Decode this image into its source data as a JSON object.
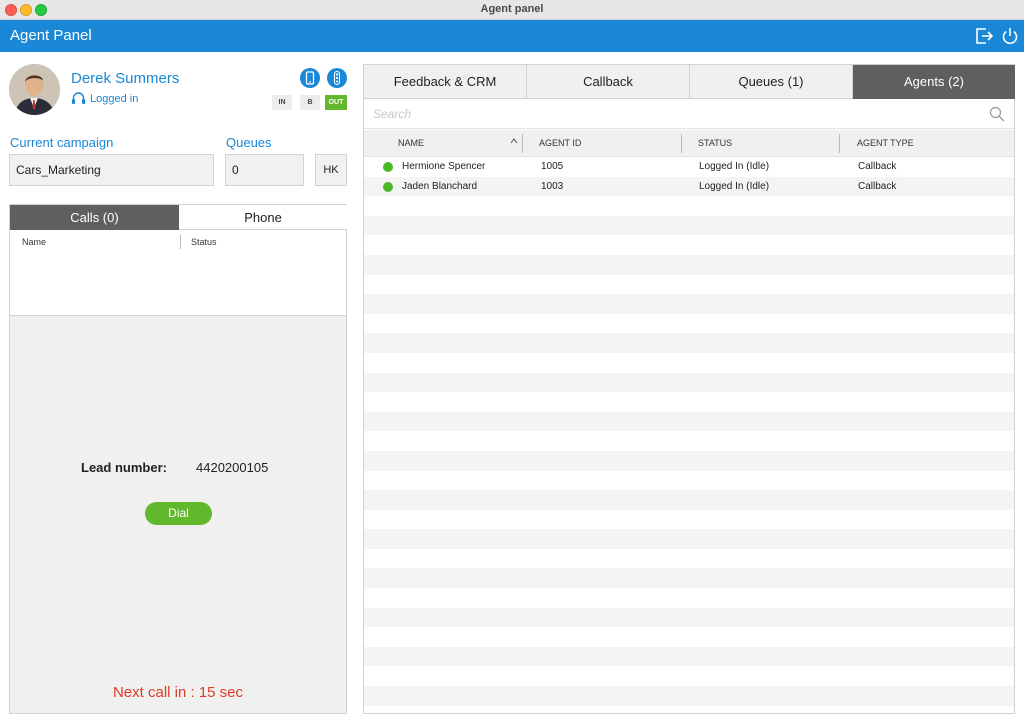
{
  "window": {
    "title": "Agent panel"
  },
  "header": {
    "title": "Agent Panel",
    "logout_icon": "logout-icon",
    "power_icon": "power-icon"
  },
  "colors": {
    "header_blue": "#1a88d6",
    "active_tab": "#5f5f5f",
    "green": "#61b82d",
    "alert_red": "#e03b24"
  },
  "agent": {
    "name": "Derek Summers",
    "status": "Logged in"
  },
  "modes": {
    "in": "IN",
    "b": "B",
    "out": "OUT",
    "active": "OUT"
  },
  "campaign": {
    "label": "Current campaign",
    "value": "Cars_Marketing"
  },
  "queues": {
    "label": "Queues",
    "value": "0",
    "hk_label": "HK"
  },
  "left_tabs": {
    "calls": "Calls (0)",
    "phone": "Phone",
    "active": "Calls (0)"
  },
  "calls_table": {
    "columns": [
      "Name",
      "Status"
    ]
  },
  "lead": {
    "label": "Lead number:",
    "number": "4420200105",
    "dial_label": "Dial"
  },
  "next_call": "Next call in : 15 sec",
  "right_tabs": [
    "Feedback & CRM",
    "Callback",
    "Queues (1)",
    "Agents (2)"
  ],
  "active_right_tab": "Agents (2)",
  "search": {
    "placeholder": "Search",
    "value": ""
  },
  "agents_table": {
    "columns": [
      "NAME",
      "AGENT ID",
      "STATUS",
      "AGENT TYPE"
    ],
    "sorted_by": "NAME",
    "rows": [
      {
        "name": "Hermione Spencer",
        "agent_id": "1005",
        "status": "Logged In (Idle)",
        "agent_type": "Callback",
        "dot": "green"
      },
      {
        "name": "Jaden Blanchard",
        "agent_id": "1003",
        "status": "Logged In (Idle)",
        "agent_type": "Callback",
        "dot": "green"
      }
    ]
  }
}
